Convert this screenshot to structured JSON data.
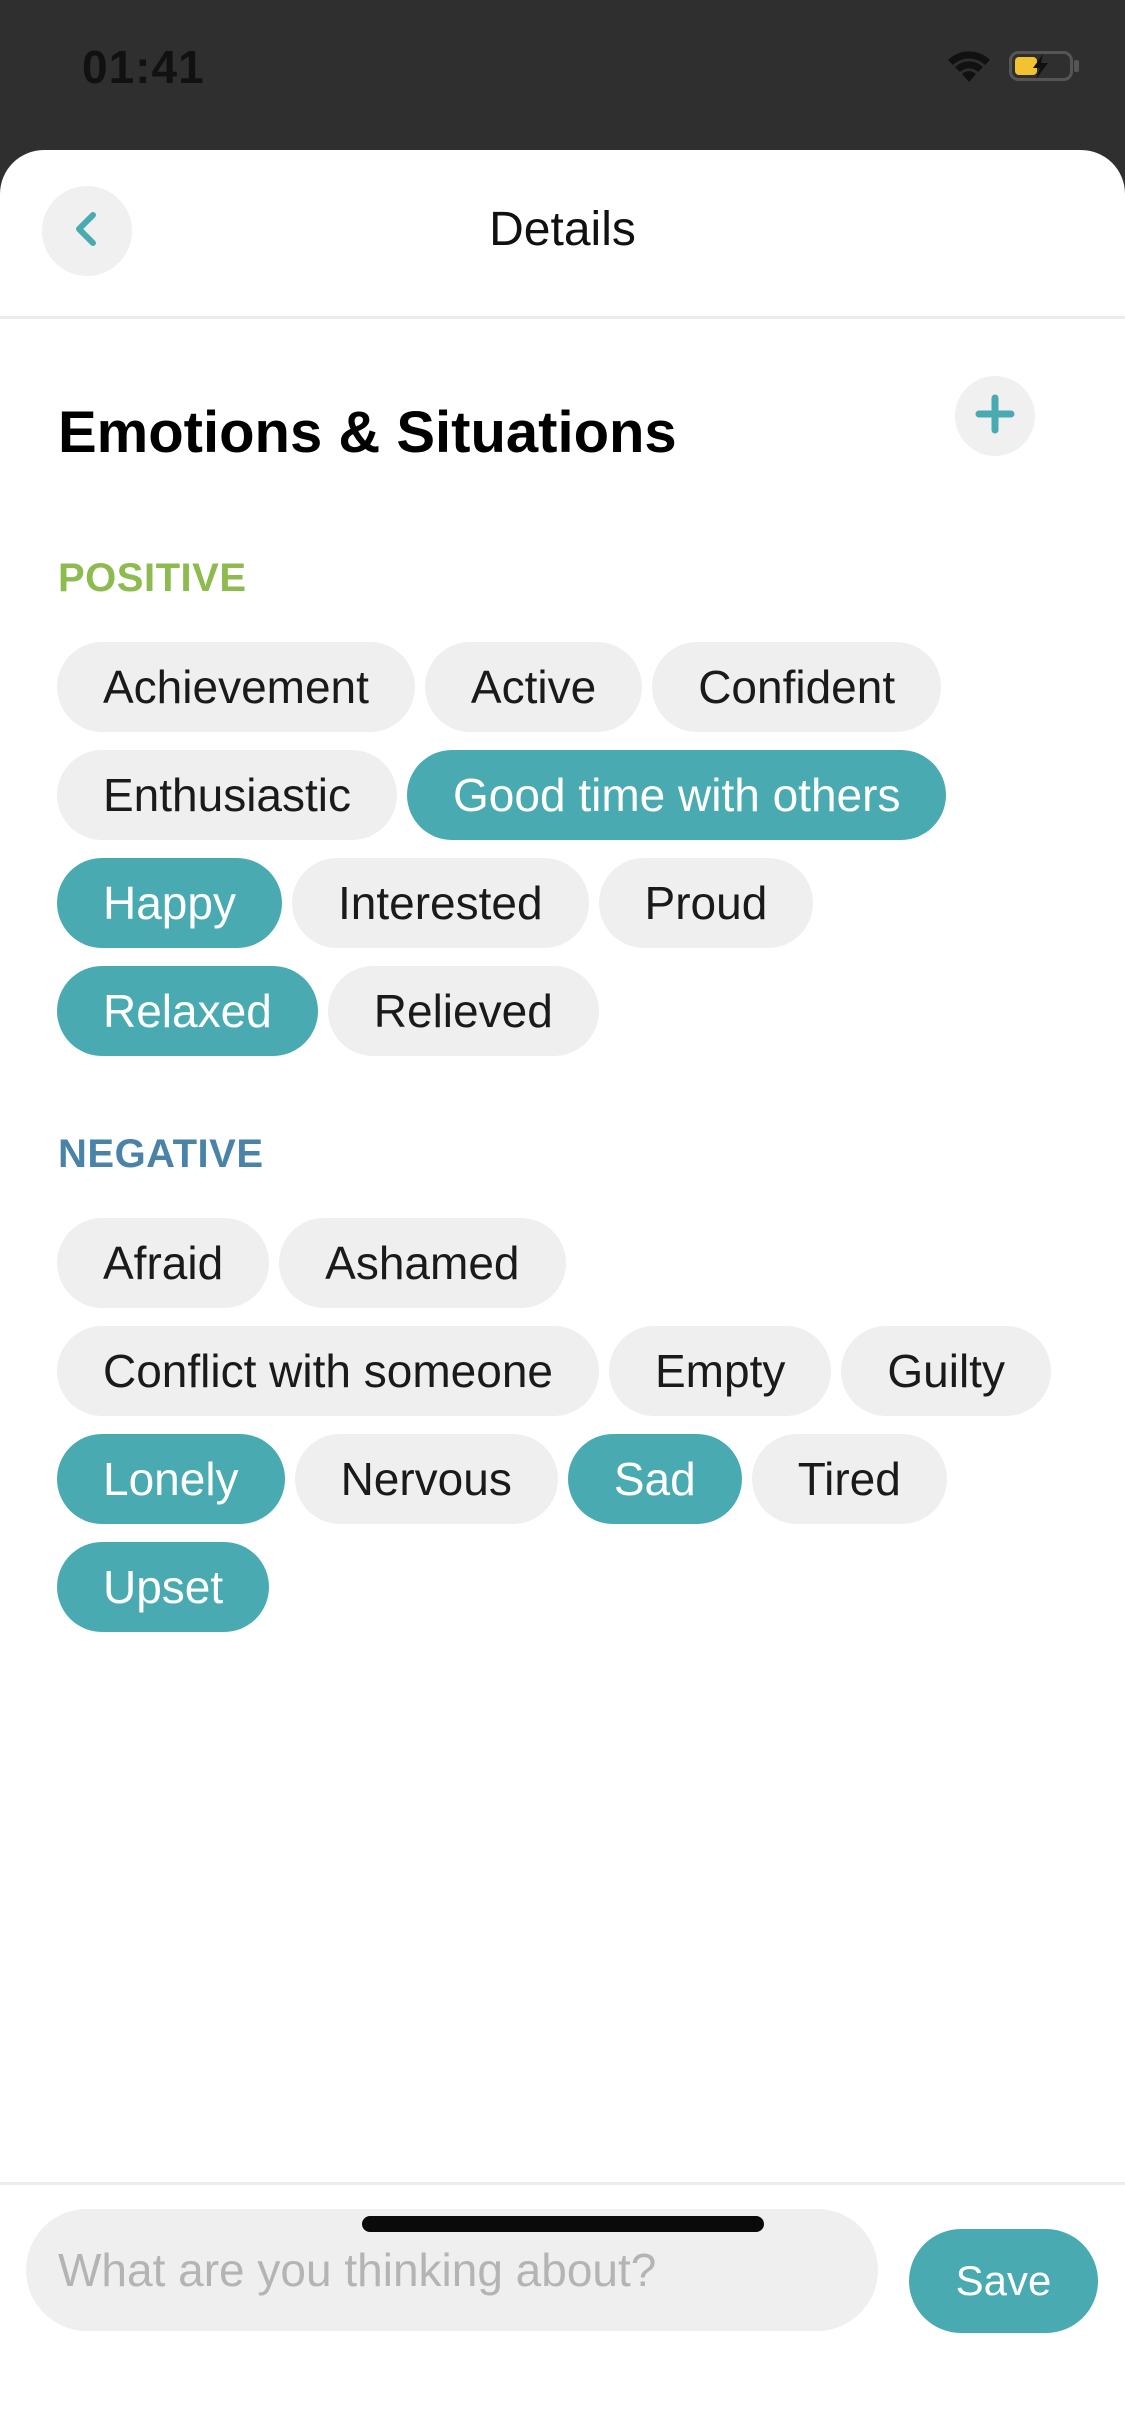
{
  "status_bar": {
    "time": "01:41",
    "icons": [
      "wifi-icon",
      "battery-charging-icon"
    ]
  },
  "nav": {
    "title": "Details",
    "back_icon": "chevron-left-icon"
  },
  "section": {
    "title": "Emotions & Situations",
    "add_icon": "plus-icon"
  },
  "positive": {
    "label": "POSITIVE",
    "label_color": "#8dbb4f",
    "chips": [
      {
        "label": "Achievement",
        "selected": false
      },
      {
        "label": "Active",
        "selected": false
      },
      {
        "label": "Confident",
        "selected": false
      },
      {
        "label": "Enthusiastic",
        "selected": false
      },
      {
        "label": "Good time with others",
        "selected": true
      },
      {
        "label": "Happy",
        "selected": true
      },
      {
        "label": "Interested",
        "selected": false
      },
      {
        "label": "Proud",
        "selected": false
      },
      {
        "label": "Relaxed",
        "selected": true
      },
      {
        "label": "Relieved",
        "selected": false
      }
    ]
  },
  "negative": {
    "label": "NEGATIVE",
    "label_color": "#4a83a8",
    "chips": [
      {
        "label": "Afraid",
        "selected": false
      },
      {
        "label": "Ashamed",
        "selected": false
      },
      {
        "label": "Conflict with someone",
        "selected": false
      },
      {
        "label": "Empty",
        "selected": false
      },
      {
        "label": "Guilty",
        "selected": false
      },
      {
        "label": "Lonely",
        "selected": true
      },
      {
        "label": "Nervous",
        "selected": false
      },
      {
        "label": "Sad",
        "selected": true
      },
      {
        "label": "Tired",
        "selected": false
      },
      {
        "label": "Upset",
        "selected": true
      }
    ]
  },
  "colors": {
    "accent": "#4aaab2",
    "chip_bg": "#efefef"
  },
  "composer": {
    "placeholder": "What are you thinking about?",
    "value": "",
    "save_label": "Save"
  }
}
